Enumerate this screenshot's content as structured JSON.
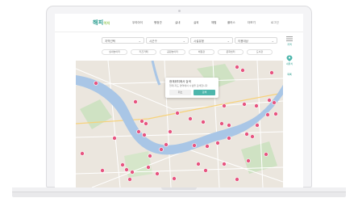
{
  "brand": {
    "name": "해피",
    "suffix": "이지",
    "accent": "#2a9d8f",
    "pin_color": "#e75480"
  },
  "nav": {
    "menu": [
      "우리아이",
      "행정관",
      "실내",
      "실외",
      "체험",
      "플러스",
      "더보기"
    ],
    "login": "로그인"
  },
  "filters": [
    {
      "label": "지역선택"
    },
    {
      "label": "시군구"
    },
    {
      "label": "시설유형"
    },
    {
      "label": "이용대상"
    }
  ],
  "chips": [
    "실내놀이터",
    "키즈카페",
    "공원놀이터",
    "체험관",
    "문화센터",
    "도서관"
  ],
  "side": {
    "top_label": "지역",
    "mid_label": "내위치",
    "bottom_label": "목록"
  },
  "popup": {
    "title": "현재위치에서 검색",
    "text": "현재 지도 영역에서 시설을 검색합니다",
    "cancel": "취소",
    "confirm": "검색"
  }
}
